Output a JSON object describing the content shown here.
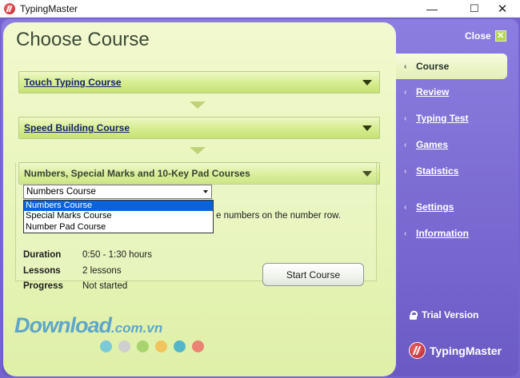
{
  "window": {
    "title": "TypingMaster",
    "minimize_glyph": "—",
    "maximize_glyph": "☐",
    "close_glyph": "✕"
  },
  "main": {
    "title": "Choose Course",
    "courses": [
      {
        "label": "Touch Typing Course",
        "expanded": false
      },
      {
        "label": "Speed Building Course",
        "expanded": false
      },
      {
        "label": "Numbers, Special Marks and 10-Key Pad Courses",
        "expanded": true
      }
    ],
    "select": {
      "value": "Numbers Course",
      "options": [
        "Numbers Course",
        "Special Marks Course",
        "Number Pad Course"
      ],
      "selected_index": 0
    },
    "description_fragment": "e numbers on the number row.",
    "info": {
      "duration_label": "Duration",
      "duration_value": "0:50 - 1:30 hours",
      "lessons_label": "Lessons",
      "lessons_value": "2 lessons",
      "progress_label": "Progress",
      "progress_value": "Not started"
    },
    "start_button": "Start Course"
  },
  "watermark": {
    "text": "Download",
    "suffix": ".com.vn",
    "dot_colors": [
      "#7ccad6",
      "#cfcfcf",
      "#a9d36e",
      "#f2c45e",
      "#56b6c9",
      "#ea8374"
    ]
  },
  "sidebar": {
    "close_label": "Close",
    "close_glyph": "✕",
    "items": [
      {
        "label": "Course",
        "active": true
      },
      {
        "label": "Review",
        "active": false
      },
      {
        "label": "Typing Test",
        "active": false
      },
      {
        "label": "Games",
        "active": false
      },
      {
        "label": "Statistics",
        "active": false
      },
      {
        "label": "Settings",
        "active": false
      },
      {
        "label": "Information",
        "active": false
      }
    ],
    "chevron_glyph": "‹",
    "trial_label": "Trial Version",
    "brand_name": "TypingMaster"
  },
  "colors": {
    "frame_purple": "#7564cf",
    "panel_green": "#eaf6bf",
    "link_blue": "#15256a",
    "selected_option": "#0a63d8"
  }
}
